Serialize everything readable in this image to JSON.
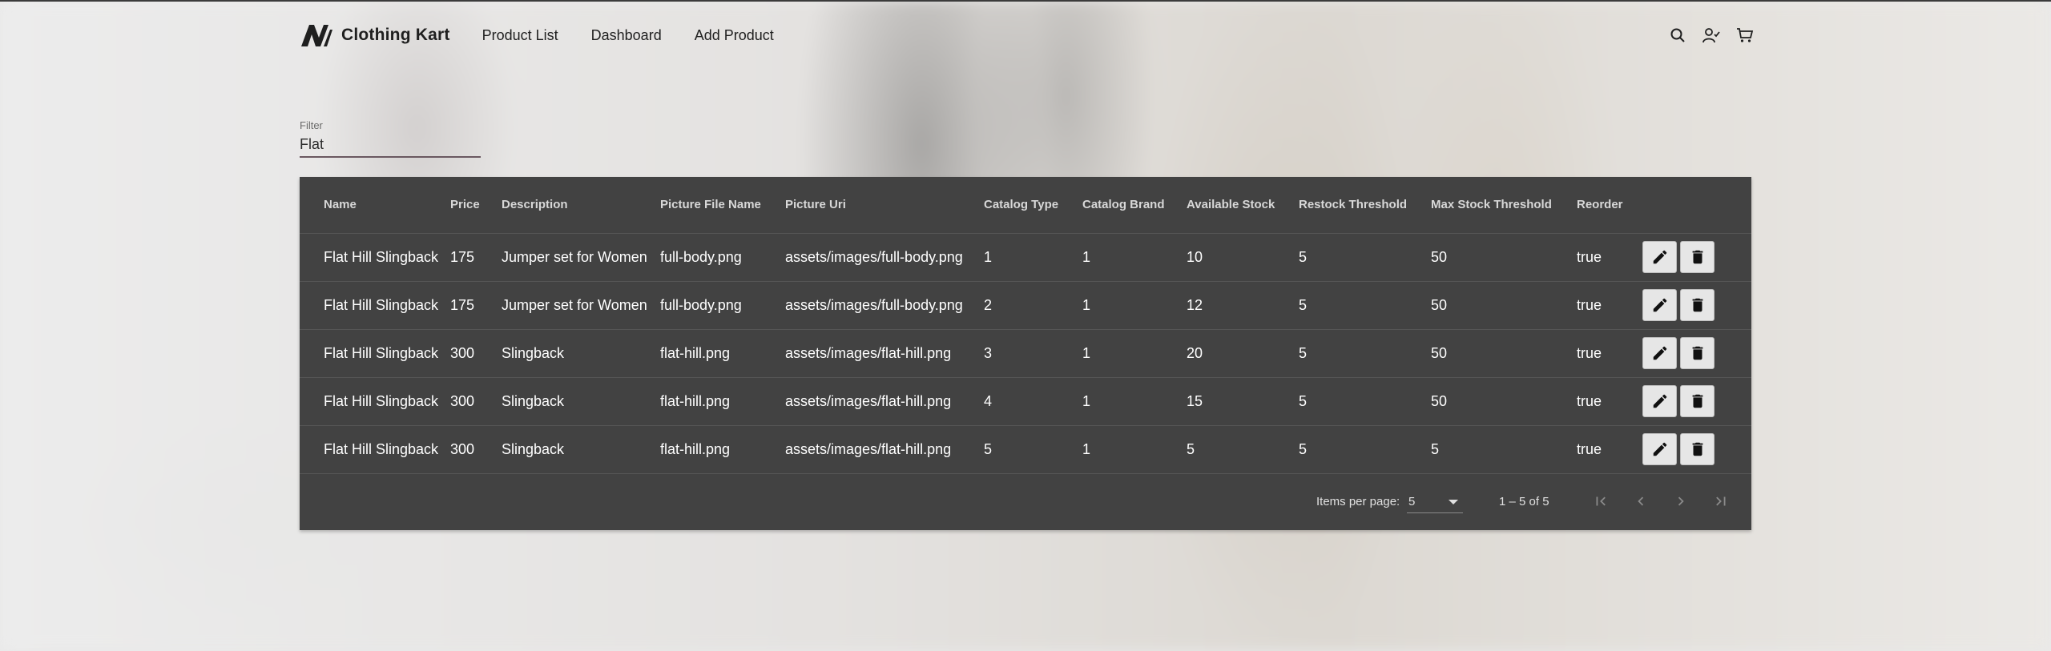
{
  "app": {
    "brand": "Clothing Kart",
    "nav": [
      "Product List",
      "Dashboard",
      "Add Product"
    ],
    "icons": [
      "search-icon",
      "user-check-icon",
      "cart-icon"
    ]
  },
  "filter": {
    "label": "Filter",
    "value": "Flat"
  },
  "table": {
    "columns": [
      "Name",
      "Price",
      "Description",
      "Picture File Name",
      "Picture Uri",
      "Catalog Type",
      "Catalog Brand",
      "Available Stock",
      "Restock Threshold",
      "Max Stock Threshold",
      "Reorder"
    ],
    "rows": [
      [
        "Flat Hill Slingback",
        "175",
        "Jumper set for Women",
        "full-body.png",
        "assets/images/full-body.png",
        "1",
        "1",
        "10",
        "5",
        "50",
        "true"
      ],
      [
        "Flat Hill Slingback",
        "175",
        "Jumper set for Women",
        "full-body.png",
        "assets/images/full-body.png",
        "2",
        "1",
        "12",
        "5",
        "50",
        "true"
      ],
      [
        "Flat Hill Slingback",
        "300",
        "Slingback",
        "flat-hill.png",
        "assets/images/flat-hill.png",
        "3",
        "1",
        "20",
        "5",
        "50",
        "true"
      ],
      [
        "Flat Hill Slingback",
        "300",
        "Slingback",
        "flat-hill.png",
        "assets/images/flat-hill.png",
        "4",
        "1",
        "15",
        "5",
        "50",
        "true"
      ],
      [
        "Flat Hill Slingback",
        "300",
        "Slingback",
        "flat-hill.png",
        "assets/images/flat-hill.png",
        "5",
        "1",
        "5",
        "5",
        "5",
        "true"
      ]
    ],
    "row_actions": [
      "edit-icon",
      "delete-icon"
    ]
  },
  "paginator": {
    "items_per_page_label": "Items per page:",
    "items_per_page": "5",
    "range": "1 – 5 of 5"
  },
  "colors": {
    "table_bg": "#424242",
    "header_text": "#1f1f1f",
    "filter_underline": "#6a5860"
  }
}
